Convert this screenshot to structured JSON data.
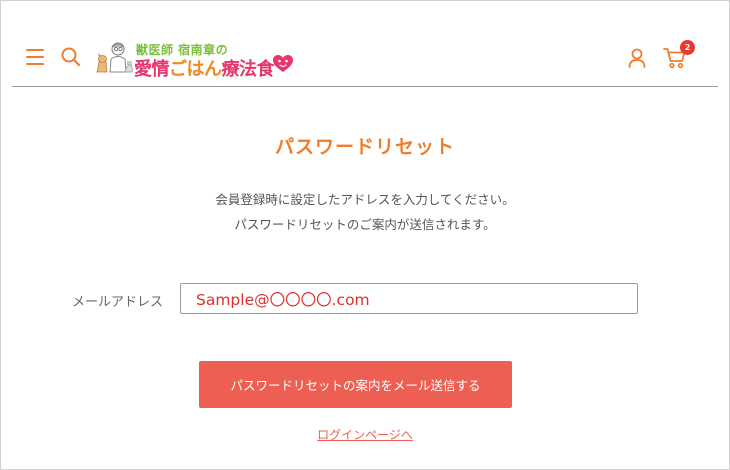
{
  "header": {
    "icons": {
      "menu": "hamburger-menu-icon",
      "search": "search-icon",
      "account": "user-icon",
      "cart": "cart-icon"
    },
    "logo": {
      "subtitle": "獣医師 宿南章の",
      "title_part1": "愛情",
      "title_part2": "ごはん",
      "title_part3": "療法食"
    },
    "cart_count": "2"
  },
  "main": {
    "title": "パスワードリセット",
    "description_line1": "会員登録時に設定したアドレスを入力してください。",
    "description_line2": "パスワードリセットのご案内が送信されます。",
    "email_label": "メールアドレス",
    "email_value": "Sample@〇〇〇〇.com",
    "submit_label": "パスワードリセットの案内をメール送信する",
    "login_link": "ログインページへ"
  },
  "colors": {
    "accent_orange": "#f07d2b",
    "button_red": "#ec5f52",
    "input_text_red": "#e0302c",
    "badge_red": "#e63a2e",
    "logo_green": "#7cbf3a",
    "logo_pink": "#e8356b"
  }
}
